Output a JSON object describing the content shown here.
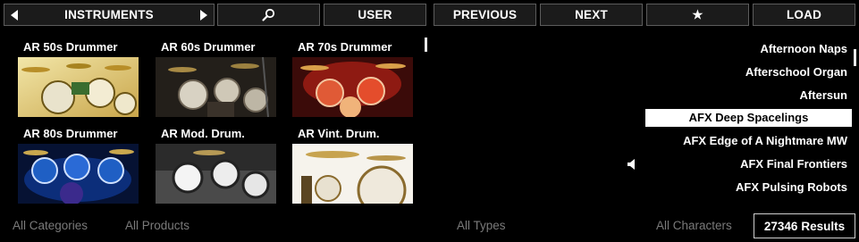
{
  "toolbar": {
    "category_label": "INSTRUMENTS",
    "user_label": "USER",
    "previous_label": "PREVIOUS",
    "next_label": "NEXT",
    "favorite_symbol": "★",
    "load_label": "LOAD"
  },
  "products": [
    {
      "label": "AR 50s Drummer"
    },
    {
      "label": "AR 60s Drummer"
    },
    {
      "label": "AR 70s Drummer"
    },
    {
      "label": "AR 80s Drummer"
    },
    {
      "label": "AR Mod. Drum."
    },
    {
      "label": "AR Vint. Drum."
    }
  ],
  "presets": [
    {
      "label": "Afternoon Naps",
      "selected": false
    },
    {
      "label": "Afterschool Organ",
      "selected": false
    },
    {
      "label": "Aftersun",
      "selected": false
    },
    {
      "label": "AFX Deep Spacelings",
      "selected": true
    },
    {
      "label": "AFX Edge of A Nightmare MW",
      "selected": false
    },
    {
      "label": "AFX Final Frontiers",
      "selected": false
    },
    {
      "label": "AFX Pulsing Robots",
      "selected": false
    }
  ],
  "footer": {
    "categories_filter": "All Categories",
    "products_filter": "All Products",
    "types_filter": "All Types",
    "characters_filter": "All Characters",
    "results_count": "27346",
    "results_label": "Results"
  },
  "icons": {
    "search": "search-icon",
    "speaker": "speaker-icon",
    "prev_arrow": "triangle-left-icon",
    "next_arrow": "triangle-right-icon"
  }
}
